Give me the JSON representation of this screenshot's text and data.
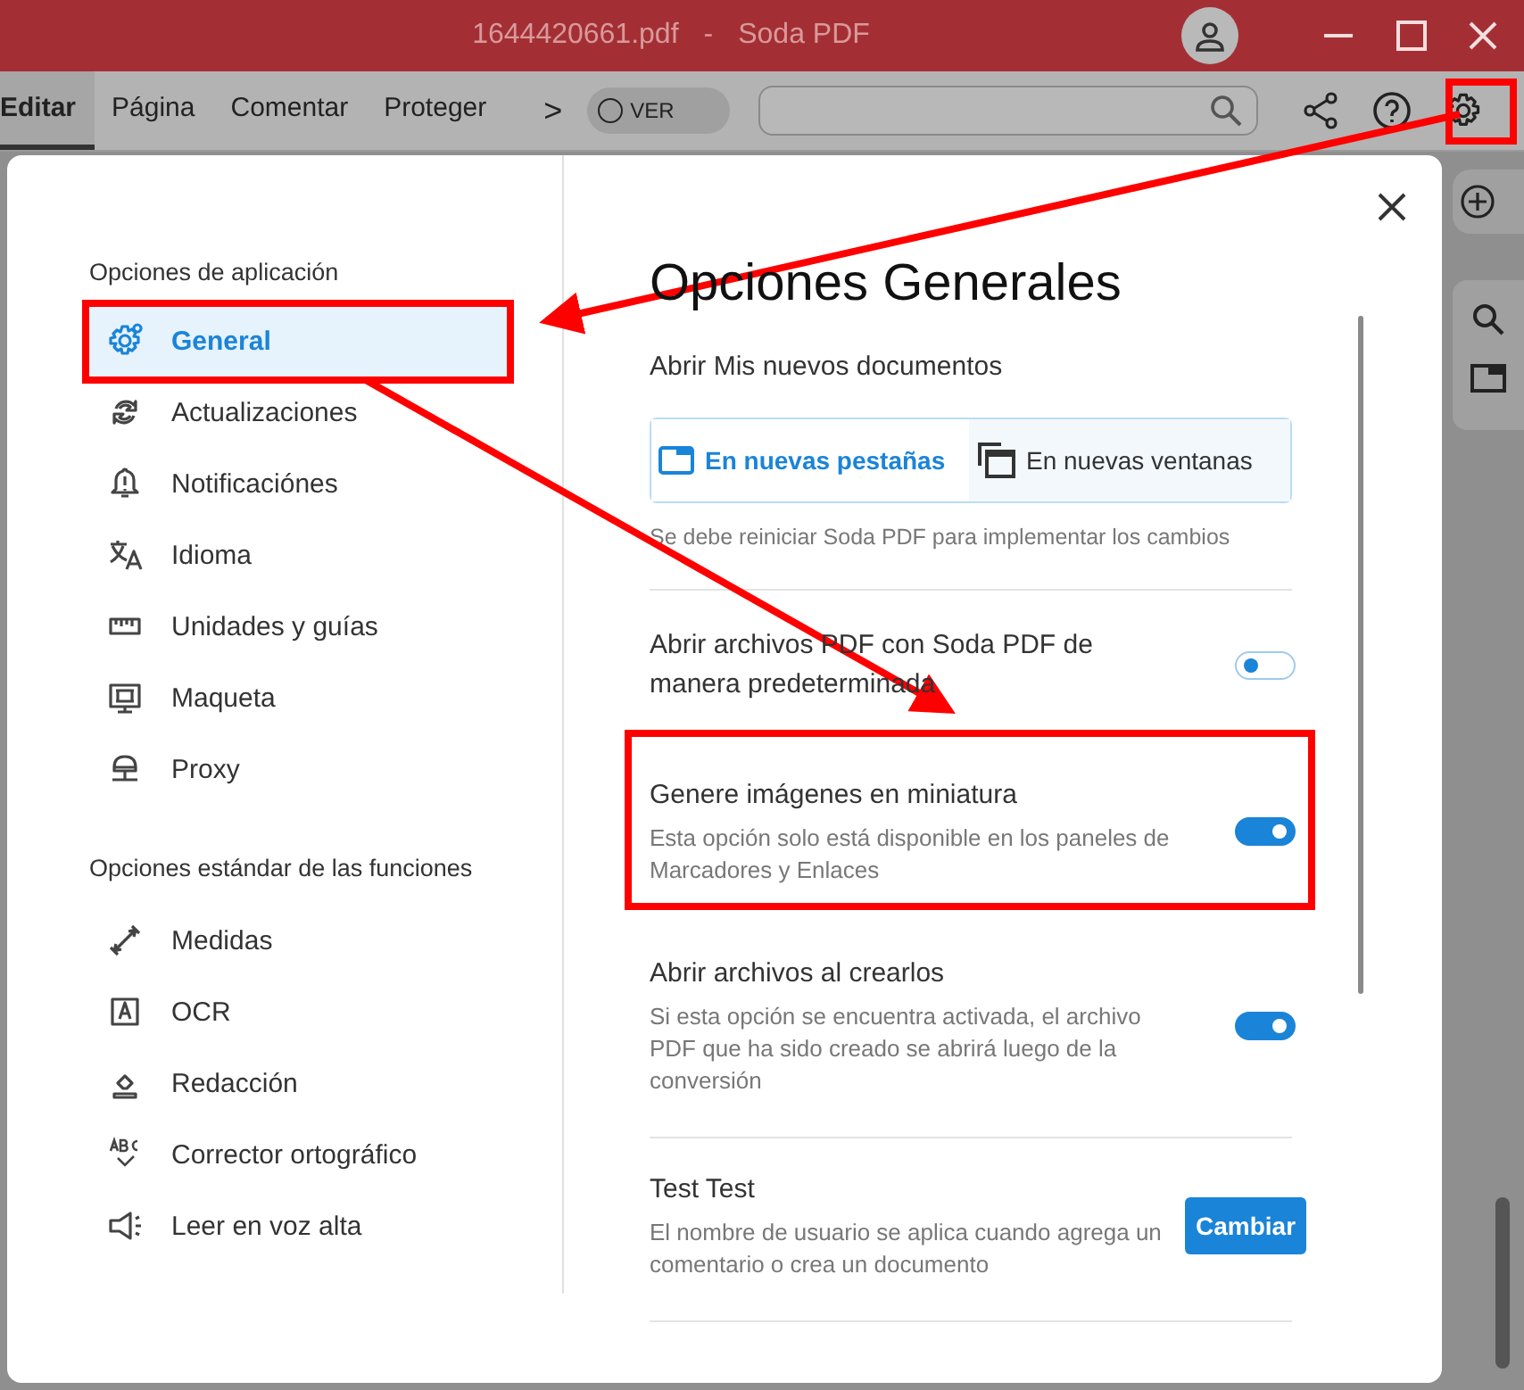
{
  "window": {
    "file_name": "1644420661.pdf",
    "separator": "-",
    "app_name": "Soda PDF"
  },
  "toolbar": {
    "tabs": [
      {
        "label": "Editar",
        "selected": true
      },
      {
        "label": "Página",
        "selected": false
      },
      {
        "label": "Comentar",
        "selected": false
      },
      {
        "label": "Proteger",
        "selected": false
      }
    ],
    "more": ">",
    "view_toggle": {
      "label": "VER",
      "on": false
    }
  },
  "dialog": {
    "sidebar": [
      {
        "heading": "Opciones de aplicación",
        "items": [
          {
            "label": "General",
            "selected": true
          },
          {
            "label": "Actualizaciones",
            "selected": false
          },
          {
            "label": "Notificaciónes",
            "selected": false
          },
          {
            "label": "Idioma",
            "selected": false
          },
          {
            "label": "Unidades y guías",
            "selected": false
          },
          {
            "label": "Maqueta",
            "selected": false
          },
          {
            "label": "Proxy",
            "selected": false
          }
        ]
      },
      {
        "heading": "Opciones estándar de las funciones",
        "items": [
          {
            "label": "Medidas",
            "selected": false
          },
          {
            "label": "OCR",
            "selected": false
          },
          {
            "label": "Redacción",
            "selected": false
          },
          {
            "label": "Corrector ortográfico",
            "selected": false
          },
          {
            "label": "Leer en voz alta",
            "selected": false
          }
        ]
      }
    ],
    "title": "Opciones Generales",
    "open_label": "Abrir Mis nuevos documentos",
    "open_options": [
      {
        "label": "En nuevas pestañas",
        "selected": true
      },
      {
        "label": "En nuevas ventanas",
        "selected": false
      }
    ],
    "note": "Se debe reiniciar Soda PDF para implementar los cambios",
    "settings": [
      {
        "kind": "toggle",
        "title": "Abrir archivos PDF con Soda PDF de manera predeterminada",
        "on": false
      },
      {
        "kind": "toggle",
        "title": "Genere imágenes en miniatura",
        "description": "Esta opción solo está disponible en los paneles de Marcadores y Enlaces",
        "on": true
      },
      {
        "kind": "toggle",
        "title": "Abrir archivos al crearlos",
        "description": "Si esta opción se encuentra activada, el archivo PDF que ha sido creado se abrirá luego de la conversión",
        "on": true
      },
      {
        "kind": "button",
        "title": "Test Test",
        "description": "El nombre de usuario se aplica cuando agrega un comentario o crea un documento",
        "button": "Cambiar"
      }
    ]
  }
}
